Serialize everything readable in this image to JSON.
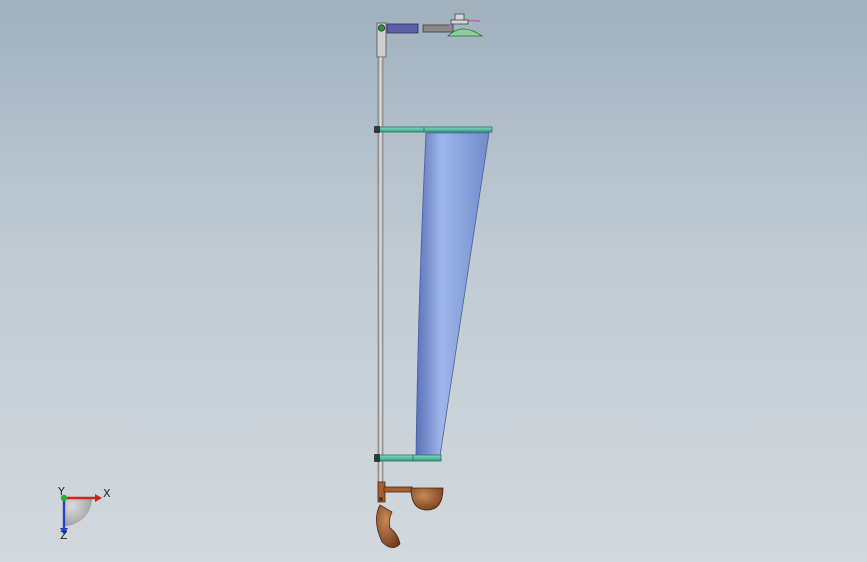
{
  "viewport": {
    "name": "3d-graphics-area"
  },
  "triad": {
    "x_label": "X",
    "y_label": "Y",
    "z_label": "Z",
    "colors": {
      "x": "#d32020",
      "y": "#27b02e",
      "z": "#2a3fc8"
    }
  },
  "colors": {
    "background_top": "#9fb1bf",
    "background_bottom": "#d2d8dd",
    "rod": "#bcbcbc",
    "plate": "#4fbfa2",
    "tapered_body": "#7c97d2",
    "actuator_cylinder": "#5c5fa6",
    "bronze_part": "#8a4a24"
  }
}
